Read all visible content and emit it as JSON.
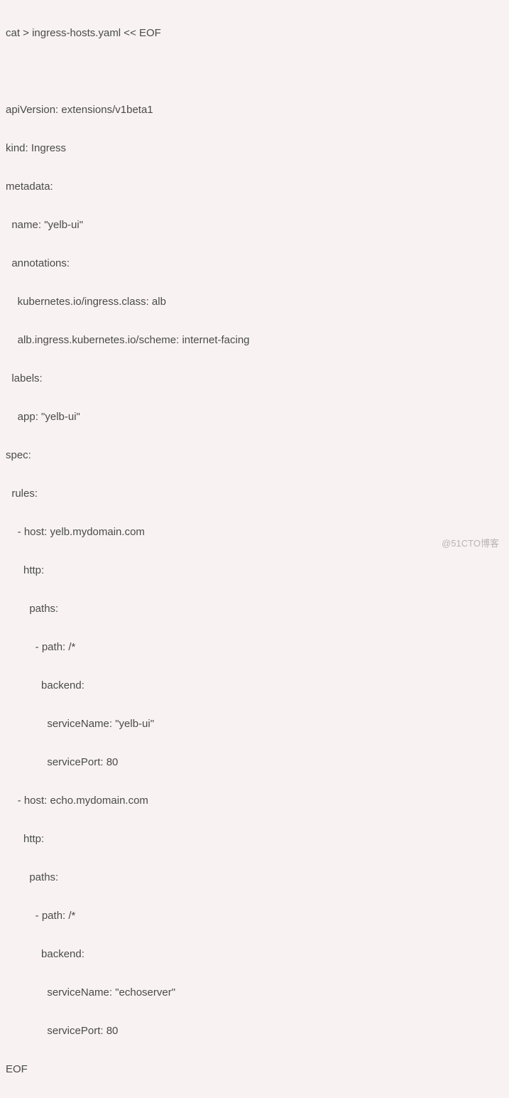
{
  "code": {
    "lines": [
      "cat > ingress-hosts.yaml << EOF",
      "",
      "apiVersion: extensions/v1beta1",
      "kind: Ingress",
      "metadata:",
      "  name: \"yelb-ui\"",
      "  annotations:",
      "    kubernetes.io/ingress.class: alb",
      "    alb.ingress.kubernetes.io/scheme: internet-facing",
      "  labels:",
      "    app: \"yelb-ui\"",
      "spec:",
      "  rules:",
      "    - host: yelb.mydomain.com",
      "      http:",
      "        paths:",
      "          - path: /*",
      "            backend:",
      "              serviceName: \"yelb-ui\"",
      "              servicePort: 80",
      "    - host: echo.mydomain.com",
      "      http:",
      "        paths:",
      "          - path: /*",
      "            backend:",
      "              serviceName: \"echoserver\"",
      "              servicePort: 80",
      "EOF"
    ]
  },
  "watermark": "@51CTO博客"
}
